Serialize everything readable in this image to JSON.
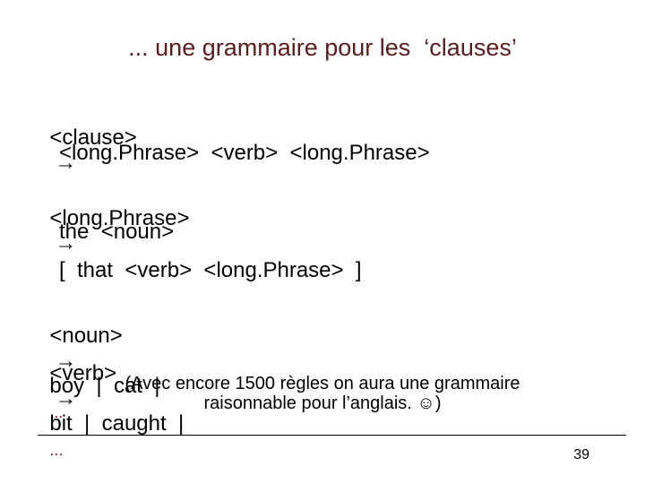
{
  "title": "... une grammaire pour les  ‘clauses’",
  "rules": [
    {
      "lhs": "<clause>",
      "arrow": "→",
      "rhs": ""
    },
    {
      "indent": "<long.Phrase>  <verb>  <long.Phrase>"
    },
    {
      "lhs": "<long.Phrase>",
      "arrow": "→",
      "rhs": ""
    },
    {
      "indent": "the  <noun>"
    },
    {
      "indent": "[  that  <verb>  <long.Phrase>  ]"
    },
    {
      "lhs": "<noun>",
      "arrow": "→",
      "rhs": "boy  |  cat  |",
      "ellipsis": "..."
    },
    {
      "lhs": "<verb>",
      "arrow": "→",
      "rhs": "bit  |  caught  |",
      "ellipsis": "..."
    }
  ],
  "note": {
    "line1": "(Avec encore 1500 règles on aura une grammaire",
    "line2": "raisonnable pour l’anglais. ☺)"
  },
  "page_number": "39"
}
